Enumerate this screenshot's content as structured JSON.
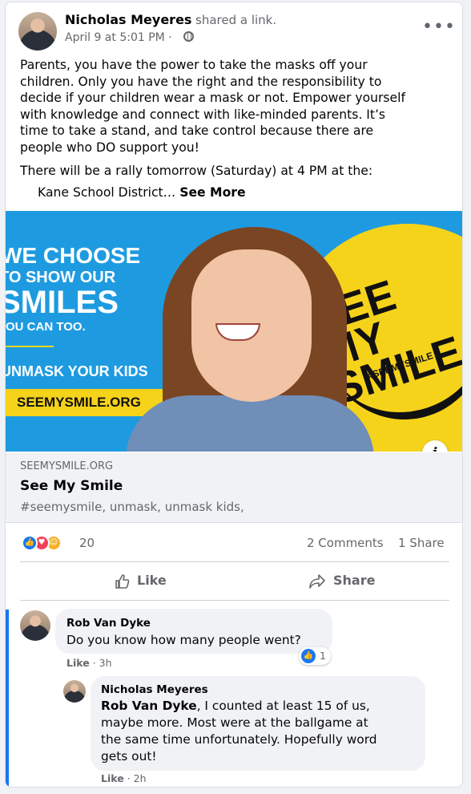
{
  "post": {
    "author": "Nicholas Meyeres",
    "action": "shared a link.",
    "timestamp": "April 9 at 5:01 PM ·",
    "privacy_icon": "globe-icon",
    "body_lines": [
      "Parents, you have the power to take the masks off your",
      "children. Only you have the right and the responsibility to",
      "decide if your children wear a mask or not. Empower yourself",
      "with knowledge and connect with like-minded parents. It’s",
      "time to take a stand, and take control because there are",
      "people who DO support you!"
    ],
    "rally_line": "There will be a rally tomorrow (Saturday) at 4 PM at the:",
    "location_line": "Kane School District…",
    "see_more": "See More"
  },
  "link_image": {
    "lines": [
      "WE CHOOSE",
      "TO SHOW OUR",
      "SMILES",
      "YOU CAN TOO.",
      "UNMASK YOUR KIDS"
    ],
    "url_badge": "SEEMYSMILE.ORG",
    "circle_title": "SEE MY SMILE",
    "circle_hashtag": "#SEEMYSMILE",
    "info_icon": "i"
  },
  "link": {
    "domain": "SEEMYSMILE.ORG",
    "title": "See My Smile",
    "description": "#seemysmile, unmask, unmask kids,"
  },
  "reactions": {
    "count": "20",
    "types": [
      "like",
      "love",
      "haha"
    ],
    "comments": "2 Comments",
    "shares": "1 Share"
  },
  "actions": {
    "like": "Like",
    "share": "Share"
  },
  "comments": [
    {
      "author": "Rob Van Dyke",
      "text": "Do you know how many people went?",
      "like_label": "Like",
      "time": "· 3h",
      "reaction_count": "1"
    },
    {
      "author": "Nicholas Meyeres",
      "mention": "Rob Van Dyke",
      "text_lines": [
        ", I counted at least 15 of us,",
        "maybe more. Most were at the ballgame at",
        "the same time unfortunately. Hopefully word",
        "gets out!"
      ],
      "like_label": "Like",
      "time": "· 2h"
    }
  ],
  "colors": {
    "accent": "#1877f2",
    "secondary_text": "#65676b",
    "yellow": "#f6d31b",
    "image_blue": "#1e9be0"
  }
}
